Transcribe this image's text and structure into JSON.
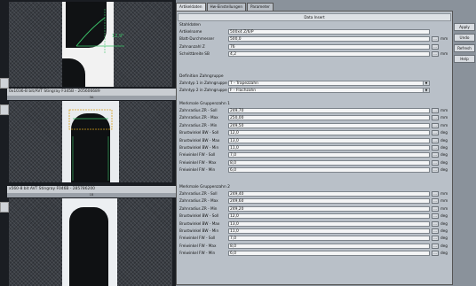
{
  "cameras": [
    {
      "label": "0x1036-B bit/AVT Stingray F345B - 205606689",
      "sub": "3A",
      "overlay": "12,9°"
    },
    {
      "label": "x560-8 bit  AVT Stingray F046B - 285786200",
      "sub": "1B"
    }
  ],
  "tabs": [
    "Artikeldaten",
    "Hw-Einstellungen",
    "Parameter"
  ],
  "status_title": "Data Insert",
  "side_buttons": [
    "Apply",
    "Undo",
    "Refresh",
    "Help"
  ],
  "groups": [
    {
      "title": "Stahldaten",
      "rows": [
        {
          "label": "Artikelname",
          "value": "500x4 Z/6/P",
          "type": "text"
        },
        {
          "label": "Blatt-Durchmesser",
          "value": "500,0",
          "unit": "mm"
        },
        {
          "label": "Zahnanzahl Z",
          "value": "76",
          "unit": ""
        },
        {
          "label": "Schnittbreite SB",
          "value": "4,2",
          "unit": "mm"
        }
      ]
    },
    {
      "title": "Definition Zahngruppe",
      "rows": [
        {
          "label": "Zahntyp 1 in Zahngruppe",
          "value": "T - Trapezzahn",
          "type": "select"
        },
        {
          "label": "Zahntyp 2 in Zahngruppe",
          "value": "F - Flachzahn",
          "type": "select"
        }
      ]
    },
    {
      "title": "Merkmale Gruppenzahn 1",
      "rows": [
        {
          "label": "Zahnradius ZR - Soll",
          "value": "249,70",
          "unit": "mm"
        },
        {
          "label": "Zahnradius ZR - Max",
          "value": "250,00",
          "unit": "mm"
        },
        {
          "label": "Zahnradius ZR - Min",
          "value": "249,50",
          "unit": "mm"
        },
        {
          "label": "Brustwinkel BW - Soll",
          "value": "12,0",
          "unit": "deg"
        },
        {
          "label": "Brustwinkel BW - Max",
          "value": "13,0",
          "unit": "deg"
        },
        {
          "label": "Brustwinkel BW - Min",
          "value": "11,0",
          "unit": "deg"
        },
        {
          "label": "Freiwinkel FW - Soll",
          "value": "7,0",
          "unit": "deg"
        },
        {
          "label": "Freiwinkel FW - Max",
          "value": "8,0",
          "unit": "deg"
        },
        {
          "label": "Freiwinkel FW - Min",
          "value": "6,0",
          "unit": "deg"
        }
      ]
    },
    {
      "title": "Merkmale Gruppenzahn 2",
      "rows": [
        {
          "label": "Zahnradius ZR - Soll",
          "value": "249,40",
          "unit": "mm"
        },
        {
          "label": "Zahnradius ZR - Max",
          "value": "249,60",
          "unit": "mm"
        },
        {
          "label": "Zahnradius ZR - Min",
          "value": "249,20",
          "unit": "mm"
        },
        {
          "label": "Brustwinkel BW - Soll",
          "value": "12,0",
          "unit": "deg"
        },
        {
          "label": "Brustwinkel BW - Max",
          "value": "13,0",
          "unit": "deg"
        },
        {
          "label": "Brustwinkel BW - Min",
          "value": "11,0",
          "unit": "deg"
        },
        {
          "label": "Freiwinkel FW - Soll",
          "value": "7,0",
          "unit": "deg"
        },
        {
          "label": "Freiwinkel FW - Max",
          "value": "8,0",
          "unit": "deg"
        },
        {
          "label": "Freiwinkel FW - Min",
          "value": "6,0",
          "unit": "deg"
        }
      ]
    }
  ],
  "colors": {
    "panel": "#8a929b",
    "frame": "#b9c0c8",
    "field": "#f4f5f6",
    "overlay_green": "#3cc46a"
  }
}
